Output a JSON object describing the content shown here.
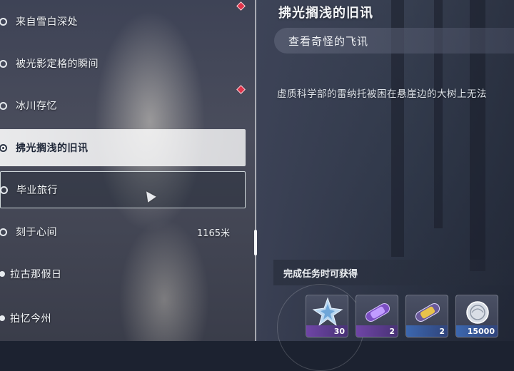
{
  "quest_list": [
    {
      "label": "来自雪白深处",
      "state": "normal",
      "bullet": "radio"
    },
    {
      "label": "被光影定格的瞬间",
      "state": "normal",
      "bullet": "radio"
    },
    {
      "label": "冰川存忆",
      "state": "normal",
      "bullet": "radio"
    },
    {
      "label": "拂光搁浅的旧讯",
      "state": "selected",
      "bullet": "radio"
    },
    {
      "label": "毕业旅行",
      "state": "hover",
      "bullet": "radio"
    },
    {
      "label": "刻于心间",
      "state": "normal",
      "bullet": "radio",
      "distance": "1165米"
    },
    {
      "label": "拉古那假日",
      "state": "normal",
      "bullet": "dot"
    },
    {
      "label": "拍忆今州",
      "state": "normal",
      "bullet": "dot"
    }
  ],
  "detail": {
    "title": "拂光搁浅的旧讯",
    "subtitle": "查看奇怪的飞讯",
    "description": "虚质科学部的雷纳托被困在悬崖边的大树上无法",
    "rewards_title": "完成任务时可获得",
    "rewards": [
      {
        "icon": "star-crystal-icon",
        "qty": "30",
        "strip": "purple"
      },
      {
        "icon": "purple-capsule-icon",
        "qty": "2",
        "strip": "purple"
      },
      {
        "icon": "gold-capsule-icon",
        "qty": "2",
        "strip": "blue"
      },
      {
        "icon": "shell-coin-icon",
        "qty": "15000",
        "strip": "blue"
      }
    ]
  },
  "colors": {
    "alert_diamond": "#e0334a",
    "selected_bg": "#ffffff",
    "hover_border": "#ebf5f5"
  }
}
